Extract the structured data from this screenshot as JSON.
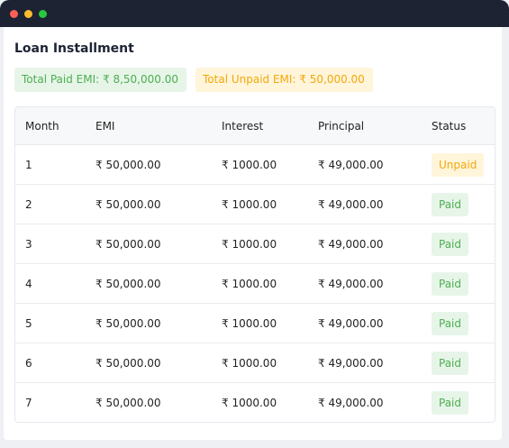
{
  "window": {
    "dots": [
      "close",
      "minimize",
      "maximize"
    ]
  },
  "page": {
    "title": "Loan Installment"
  },
  "summary": {
    "paid": "Total Paid EMI: ₹ 8,50,000.00",
    "unpaid": "Total Unpaid EMI: ₹ 50,000.00"
  },
  "table": {
    "headers": {
      "month": "Month",
      "emi": "EMI",
      "interest": "Interest",
      "principal": "Principal",
      "status": "Status"
    },
    "rows": [
      {
        "month": "1",
        "emi": "₹ 50,000.00",
        "interest": "₹ 1000.00",
        "principal": "₹ 49,000.00",
        "status": "Unpaid"
      },
      {
        "month": "2",
        "emi": "₹ 50,000.00",
        "interest": "₹ 1000.00",
        "principal": "₹ 49,000.00",
        "status": "Paid"
      },
      {
        "month": "3",
        "emi": "₹ 50,000.00",
        "interest": "₹ 1000.00",
        "principal": "₹ 49,000.00",
        "status": "Paid"
      },
      {
        "month": "4",
        "emi": "₹ 50,000.00",
        "interest": "₹ 1000.00",
        "principal": "₹ 49,000.00",
        "status": "Paid"
      },
      {
        "month": "5",
        "emi": "₹ 50,000.00",
        "interest": "₹ 1000.00",
        "principal": "₹ 49,000.00",
        "status": "Paid"
      },
      {
        "month": "6",
        "emi": "₹ 50,000.00",
        "interest": "₹ 1000.00",
        "principal": "₹ 49,000.00",
        "status": "Paid"
      },
      {
        "month": "7",
        "emi": "₹ 50,000.00",
        "interest": "₹ 1000.00",
        "principal": "₹ 49,000.00",
        "status": "Paid"
      }
    ]
  },
  "colors": {
    "titlebar": "#1d2333",
    "paid_text": "#4caf50",
    "paid_bg": "#e7f5e9",
    "unpaid_text": "#f2a80c",
    "unpaid_bg": "#fff5da"
  }
}
